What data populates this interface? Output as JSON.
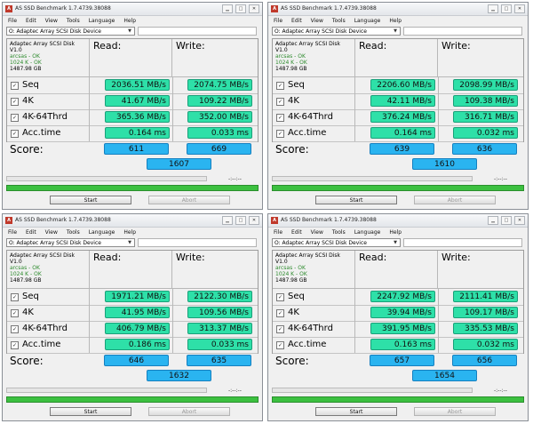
{
  "windows": [
    {
      "title": "AS SSD Benchmark 1.7.4739.38088",
      "drive": "O: Adaptec Array SCSI Disk Device",
      "info": {
        "device": "Adaptec Array SCSI Disk",
        "version": "V1.0",
        "arcsas": "arcsas - OK",
        "align": "1024 K - OK",
        "size": "1487.98 GB"
      },
      "rows": [
        {
          "label": "Seq",
          "read": "2036.51 MB/s",
          "write": "2074.75 MB/s"
        },
        {
          "label": "4K",
          "read": "41.67 MB/s",
          "write": "109.22 MB/s"
        },
        {
          "label": "4K-64Thrd",
          "read": "365.36 MB/s",
          "write": "352.00 MB/s"
        },
        {
          "label": "Acc.time",
          "read": "0.164 ms",
          "write": "0.033 ms"
        }
      ],
      "score": {
        "read": "611",
        "write": "669",
        "total": "1607"
      }
    },
    {
      "title": "AS SSD Benchmark 1.7.4739.38088",
      "drive": "O: Adaptec Array SCSI Disk Device",
      "info": {
        "device": "Adaptec Array SCSI Disk",
        "version": "V1.0",
        "arcsas": "arcsas - OK",
        "align": "1024 K - OK",
        "size": "1487.98 GB"
      },
      "rows": [
        {
          "label": "Seq",
          "read": "2206.60 MB/s",
          "write": "2098.99 MB/s"
        },
        {
          "label": "4K",
          "read": "42.11 MB/s",
          "write": "109.38 MB/s"
        },
        {
          "label": "4K-64Thrd",
          "read": "376.24 MB/s",
          "write": "316.71 MB/s"
        },
        {
          "label": "Acc.time",
          "read": "0.164 ms",
          "write": "0.032 ms"
        }
      ],
      "score": {
        "read": "639",
        "write": "636",
        "total": "1610"
      }
    },
    {
      "title": "AS SSD Benchmark 1.7.4739.38088",
      "drive": "O: Adaptec Array SCSI Disk Device",
      "info": {
        "device": "Adaptec Array SCSI Disk",
        "version": "V1.0",
        "arcsas": "arcsas - OK",
        "align": "1024 K - OK",
        "size": "1487.98 GB"
      },
      "rows": [
        {
          "label": "Seq",
          "read": "1971.21 MB/s",
          "write": "2122.30 MB/s"
        },
        {
          "label": "4K",
          "read": "41.95 MB/s",
          "write": "109.56 MB/s"
        },
        {
          "label": "4K-64Thrd",
          "read": "406.79 MB/s",
          "write": "313.37 MB/s"
        },
        {
          "label": "Acc.time",
          "read": "0.186 ms",
          "write": "0.033 ms"
        }
      ],
      "score": {
        "read": "646",
        "write": "635",
        "total": "1632"
      }
    },
    {
      "title": "AS SSD Benchmark 1.7.4739.38088",
      "drive": "O: Adaptec Array SCSI Disk Device",
      "info": {
        "device": "Adaptec Array SCSI Disk",
        "version": "V1.0",
        "arcsas": "arcsas - OK",
        "align": "1024 K - OK",
        "size": "1487.98 GB"
      },
      "rows": [
        {
          "label": "Seq",
          "read": "2247.92 MB/s",
          "write": "2111.41 MB/s"
        },
        {
          "label": "4K",
          "read": "39.94 MB/s",
          "write": "109.17 MB/s"
        },
        {
          "label": "4K-64Thrd",
          "read": "391.95 MB/s",
          "write": "335.53 MB/s"
        },
        {
          "label": "Acc.time",
          "read": "0.163 ms",
          "write": "0.032 ms"
        }
      ],
      "score": {
        "read": "657",
        "write": "656",
        "total": "1654"
      }
    }
  ],
  "menu": [
    "File",
    "Edit",
    "View",
    "Tools",
    "Language",
    "Help"
  ],
  "labels": {
    "read": "Read:",
    "write": "Write:",
    "score": "Score:",
    "start": "Start",
    "abort": "Abort",
    "timer": "-:--:--"
  },
  "icons": {
    "checkbox": "checkbox-icon",
    "app": "app-icon",
    "minimize": "minimize-icon",
    "maximize": "maximize-icon",
    "close": "close-icon",
    "dropdown": "chevron-down-icon"
  },
  "colors": {
    "result_fill": "#2ee0a8",
    "score_fill": "#2ab4f0",
    "progress_green": "#3cc040"
  }
}
